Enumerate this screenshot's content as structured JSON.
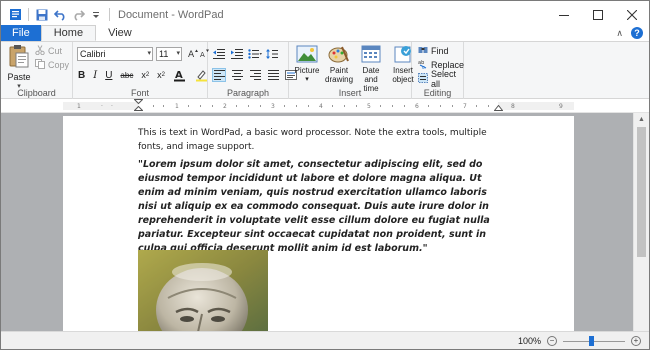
{
  "window": {
    "title": "Document - WordPad"
  },
  "colors": {
    "accent": "#1d6fd3",
    "ribbon_bg": "#f5f6f7",
    "doc_bg": "#aeb0b3"
  },
  "tabs": [
    {
      "label": "File"
    },
    {
      "label": "Home"
    },
    {
      "label": "View"
    }
  ],
  "clipboard": {
    "paste": "Paste",
    "cut": "Cut",
    "copy": "Copy",
    "group": "Clipboard"
  },
  "font": {
    "family": "Calibri",
    "size": "11",
    "group": "Font"
  },
  "paragraph": {
    "group": "Paragraph"
  },
  "insert": {
    "group": "Insert",
    "picture": "Picture",
    "paint_drawing": [
      "Paint",
      "drawing"
    ],
    "date_time": [
      "Date and",
      "time"
    ],
    "insert_object": [
      "Insert",
      "object"
    ]
  },
  "editing": {
    "group": "Editing",
    "find": "Find",
    "replace": "Replace",
    "select_all": "Select all"
  },
  "document": {
    "intro": "This is text in WordPad, a basic word processor. Note the extra tools, multiple fonts, and image support.",
    "quote": "\"Lorem ipsum dolor sit amet, consectetur adipiscing elit, sed do eiusmod tempor incididunt ut labore et dolore magna aliqua. Ut enim ad minim veniam, quis nostrud exercitation ullamco laboris nisi ut aliquip ex ea commodo consequat. Duis aute irure dolor in reprehenderit in voluptate velit esse cillum dolore eu fugiat nulla pariatur. Excepteur sint occaecat cupidatat non proident, sunt in culpa qui officia deserunt mollit anim id est laborum.\""
  },
  "status": {
    "zoom": "100%",
    "zoom_level": 0.45
  }
}
